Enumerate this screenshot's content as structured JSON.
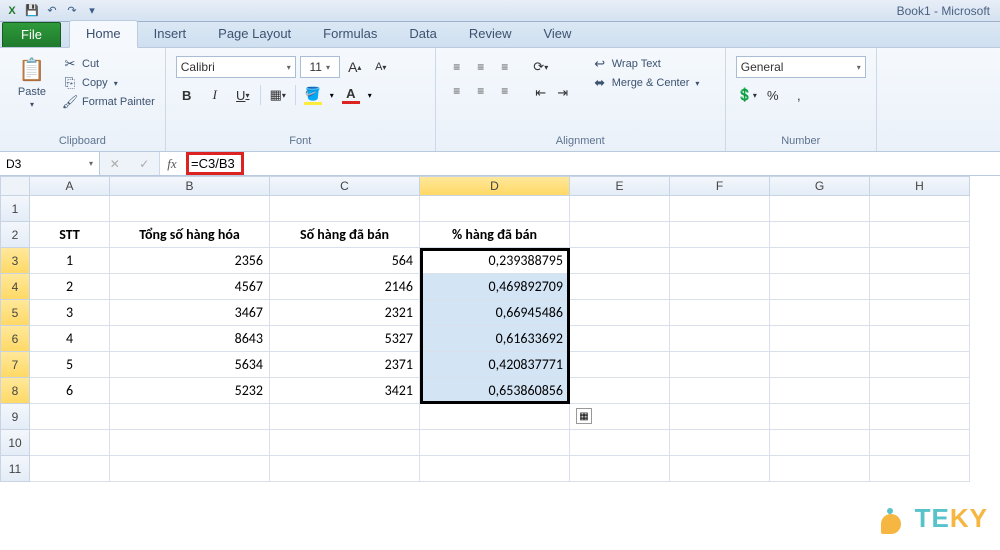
{
  "app_title": "Book1 - Microsoft",
  "tabs": {
    "file": "File",
    "home": "Home",
    "insert": "Insert",
    "pagelayout": "Page Layout",
    "formulas": "Formulas",
    "data": "Data",
    "review": "Review",
    "view": "View"
  },
  "clipboard": {
    "paste": "Paste",
    "cut": "Cut",
    "copy": "Copy",
    "format_painter": "Format Painter",
    "group": "Clipboard"
  },
  "font": {
    "name": "Calibri",
    "size": "11",
    "group": "Font"
  },
  "alignment": {
    "wrap": "Wrap Text",
    "merge": "Merge & Center",
    "group": "Alignment"
  },
  "number": {
    "format": "General",
    "group": "Number"
  },
  "namebox": "D3",
  "formula": "=C3/B3",
  "columns": [
    "A",
    "B",
    "C",
    "D",
    "E",
    "F",
    "G",
    "H"
  ],
  "headers": {
    "stt": "STT",
    "tong": "Tổng số hàng hóa",
    "daban": "Số hàng đã bán",
    "pct": "% hàng đã bán"
  },
  "rows": [
    {
      "stt": "1",
      "tong": "2356",
      "daban": "564",
      "pct": "0,239388795"
    },
    {
      "stt": "2",
      "tong": "4567",
      "daban": "2146",
      "pct": "0,469892709"
    },
    {
      "stt": "3",
      "tong": "3467",
      "daban": "2321",
      "pct": "0,66945486"
    },
    {
      "stt": "4",
      "tong": "8643",
      "daban": "5327",
      "pct": "0,61633692"
    },
    {
      "stt": "5",
      "tong": "5634",
      "daban": "2371",
      "pct": "0,420837771"
    },
    {
      "stt": "6",
      "tong": "5232",
      "daban": "3421",
      "pct": "0,653860856"
    }
  ],
  "watermark": {
    "part1": "TE",
    "part2": "KY"
  }
}
